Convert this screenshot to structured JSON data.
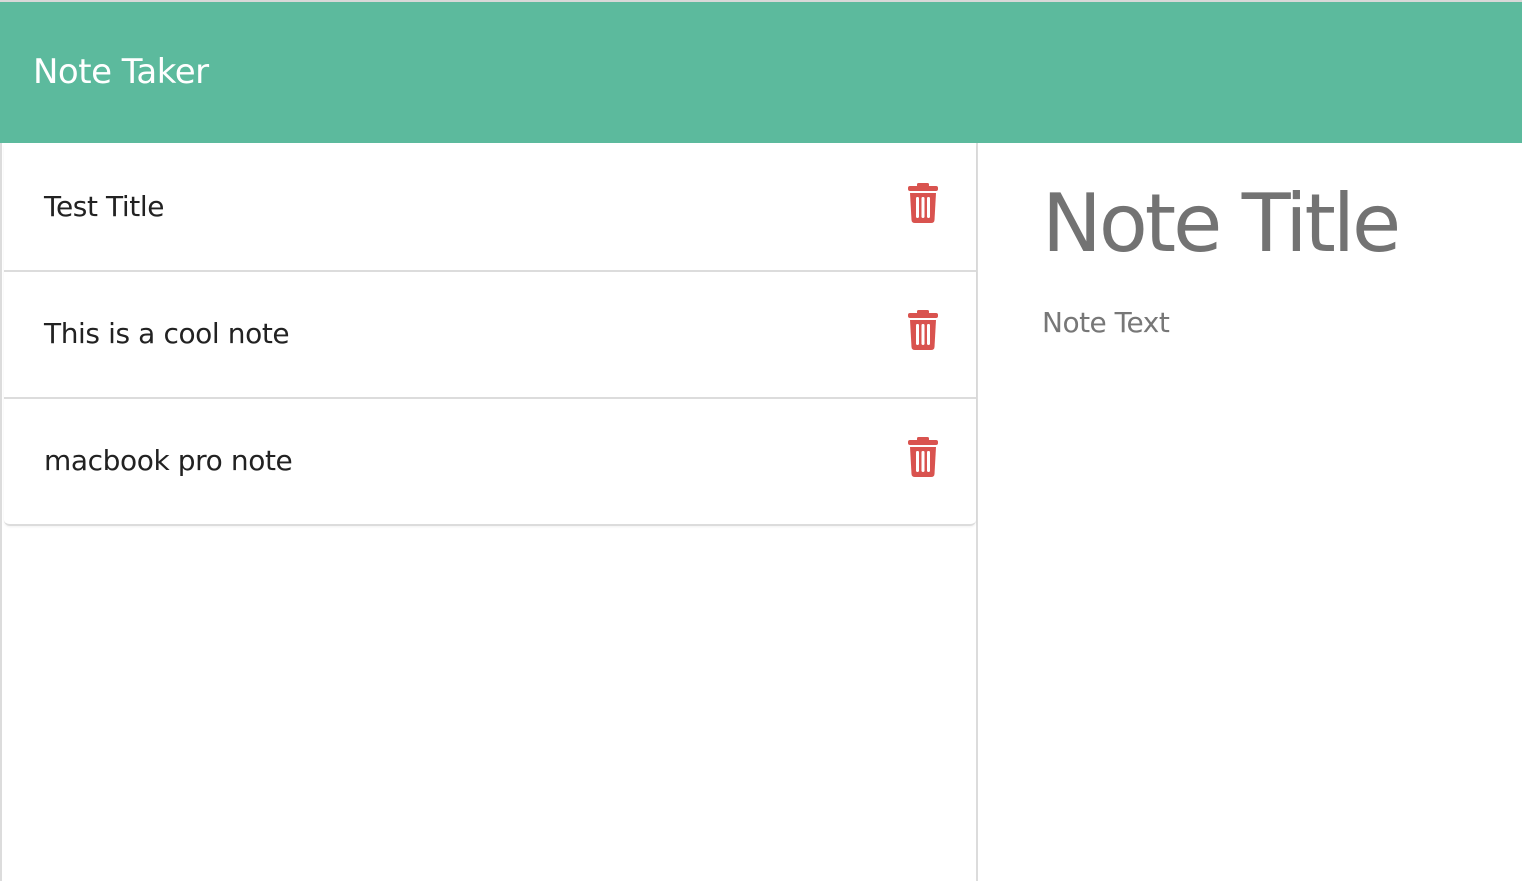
{
  "navbar": {
    "brand": "Note Taker",
    "background_color": "#5cba9d"
  },
  "notes": [
    {
      "title": "Test Title",
      "delete_icon": "trash-icon"
    },
    {
      "title": "This is a cool note",
      "delete_icon": "trash-icon"
    },
    {
      "title": "macbook pro note",
      "delete_icon": "trash-icon"
    }
  ],
  "editor": {
    "title_value": "Note Title",
    "text_value": "Note Text"
  },
  "colors": {
    "accent": "#5cba9d",
    "delete": "#d9534f",
    "text_muted": "#737373"
  }
}
